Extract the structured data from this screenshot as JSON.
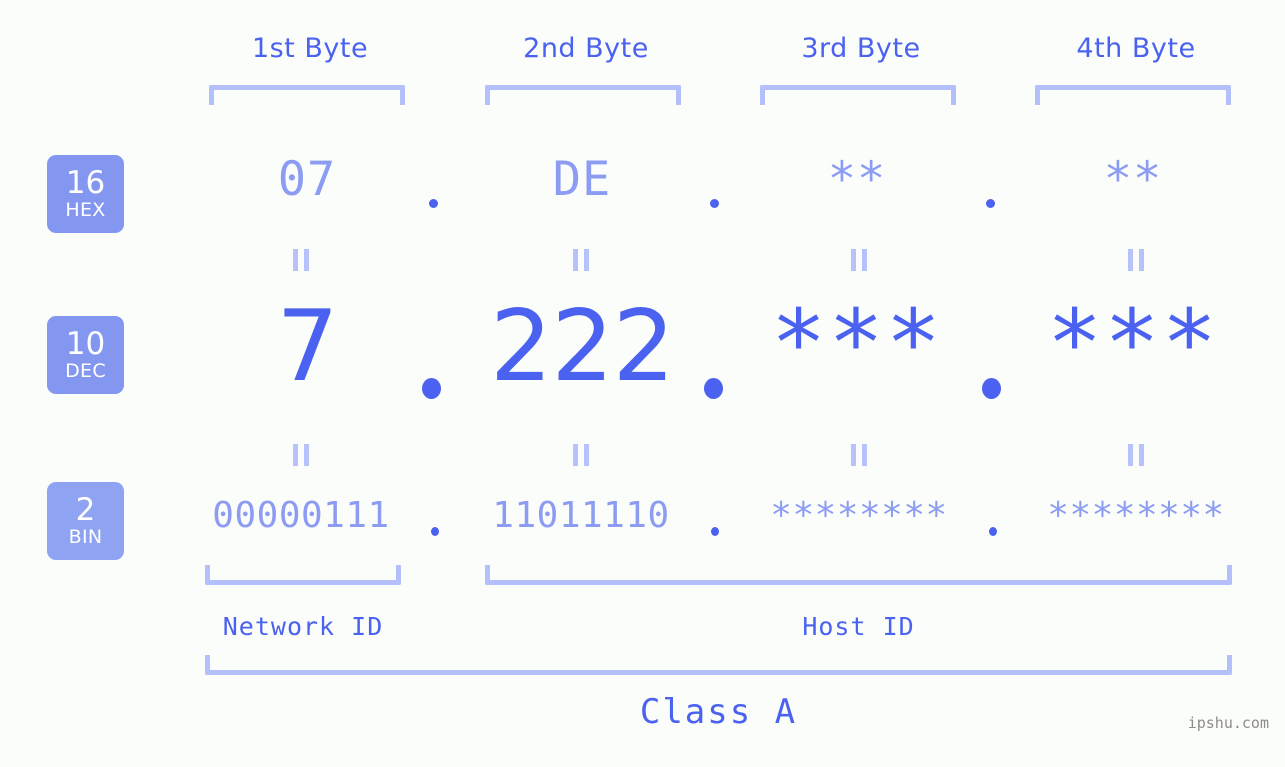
{
  "watermark": "ipshu.com",
  "columns": [
    {
      "header": "1st Byte",
      "hex": "07",
      "dec": "7",
      "bin": "00000111"
    },
    {
      "header": "2nd Byte",
      "hex": "DE",
      "dec": "222",
      "bin": "11011110"
    },
    {
      "header": "3rd Byte",
      "hex": "**",
      "dec": "***",
      "bin": "********"
    },
    {
      "header": "4th Byte",
      "hex": "**",
      "dec": "***",
      "bin": "********"
    }
  ],
  "bases": [
    {
      "num": "16",
      "name": "HEX"
    },
    {
      "num": "10",
      "name": "DEC"
    },
    {
      "num": "2",
      "name": "BIN"
    }
  ],
  "separators": {
    "dot": "."
  },
  "equals_mark": "=",
  "segments": {
    "network_id": "Network ID",
    "host_id": "Host ID"
  },
  "class_label": "Class A",
  "colors": {
    "background": "#fbfdfa",
    "accent_strong": "#4a62ef",
    "accent_light": "#8c9cf3",
    "bracket": "#b4c0fb",
    "badge": "#8497f0",
    "watermark": "#8c8c8c"
  }
}
